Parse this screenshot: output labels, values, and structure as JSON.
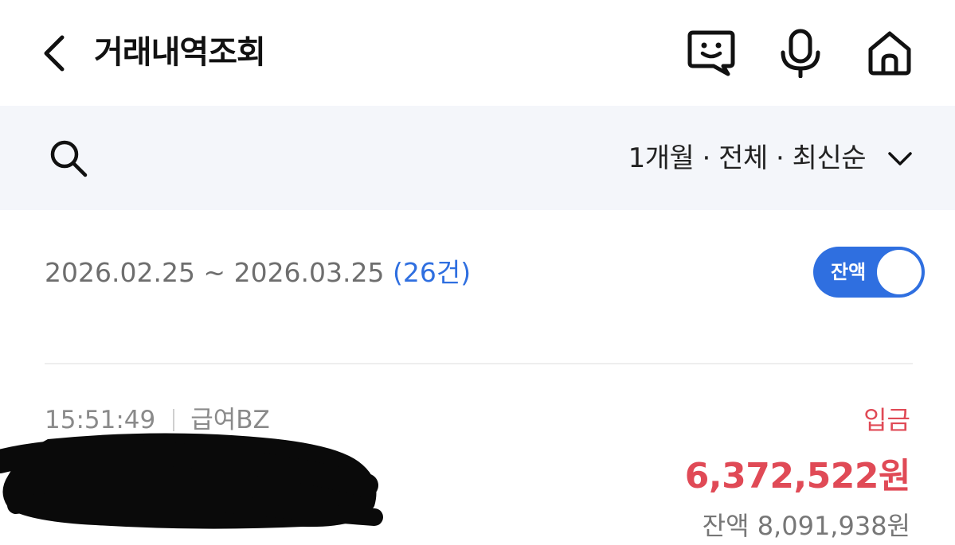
{
  "header": {
    "title": "거래내역조회",
    "icons": [
      "chevron-left-icon",
      "chatbot-icon",
      "mic-icon",
      "home-icon"
    ]
  },
  "filter": {
    "summary": "1개월 · 전체 · 최신순",
    "icons": [
      "search-icon",
      "chevron-down-icon"
    ]
  },
  "period": {
    "range": "2026.02.25 ~ 2026.03.25",
    "count": "(26건)"
  },
  "balance_toggle": {
    "label": "잔액",
    "state": "on"
  },
  "transactions": [
    {
      "time": "15:51:49",
      "memo": "급여BZ",
      "type": "입금",
      "amount": "6,372,522원",
      "balance": "잔액 8,091,938원"
    }
  ],
  "colors": {
    "accent": "#2f6fe0",
    "deposit": "#e04a56",
    "filter_bg": "#f4f6fa"
  }
}
